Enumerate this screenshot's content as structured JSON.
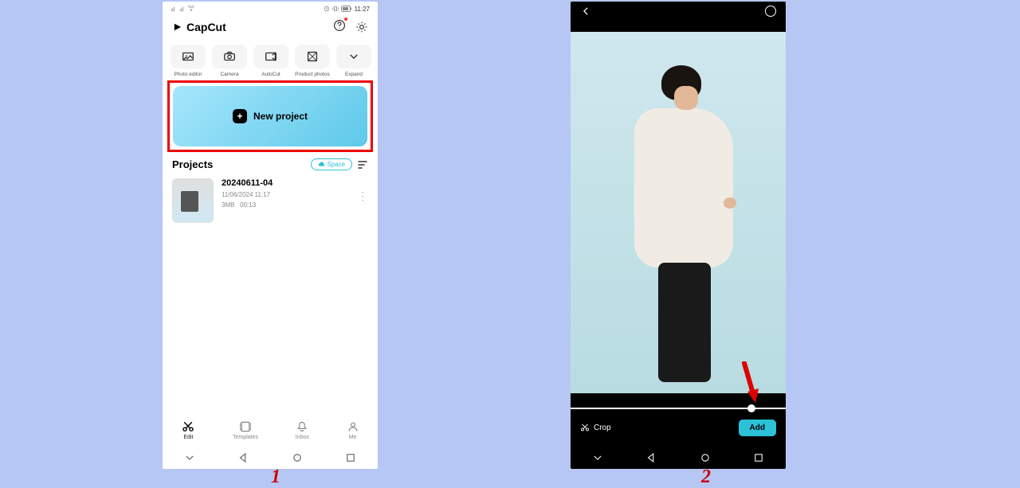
{
  "phone1": {
    "status": {
      "time": "11:27"
    },
    "app_name": "CapCut",
    "tools": [
      {
        "label": "Photo editor"
      },
      {
        "label": "Camera"
      },
      {
        "label": "AutoCut"
      },
      {
        "label": "Product photos"
      },
      {
        "label": "Expand"
      }
    ],
    "new_project_label": "New project",
    "projects_title": "Projects",
    "space_label": "Space",
    "project": {
      "name": "20240611-04",
      "datetime": "11/06/2024 11:17",
      "size": "3MB",
      "duration": "00:13"
    },
    "nav": {
      "edit": "Edit",
      "templates": "Templates",
      "inbox": "Inbox",
      "me": "Me"
    }
  },
  "phone2": {
    "crop_label": "Crop",
    "add_label": "Add"
  },
  "captions": {
    "one": "1",
    "two": "2"
  }
}
